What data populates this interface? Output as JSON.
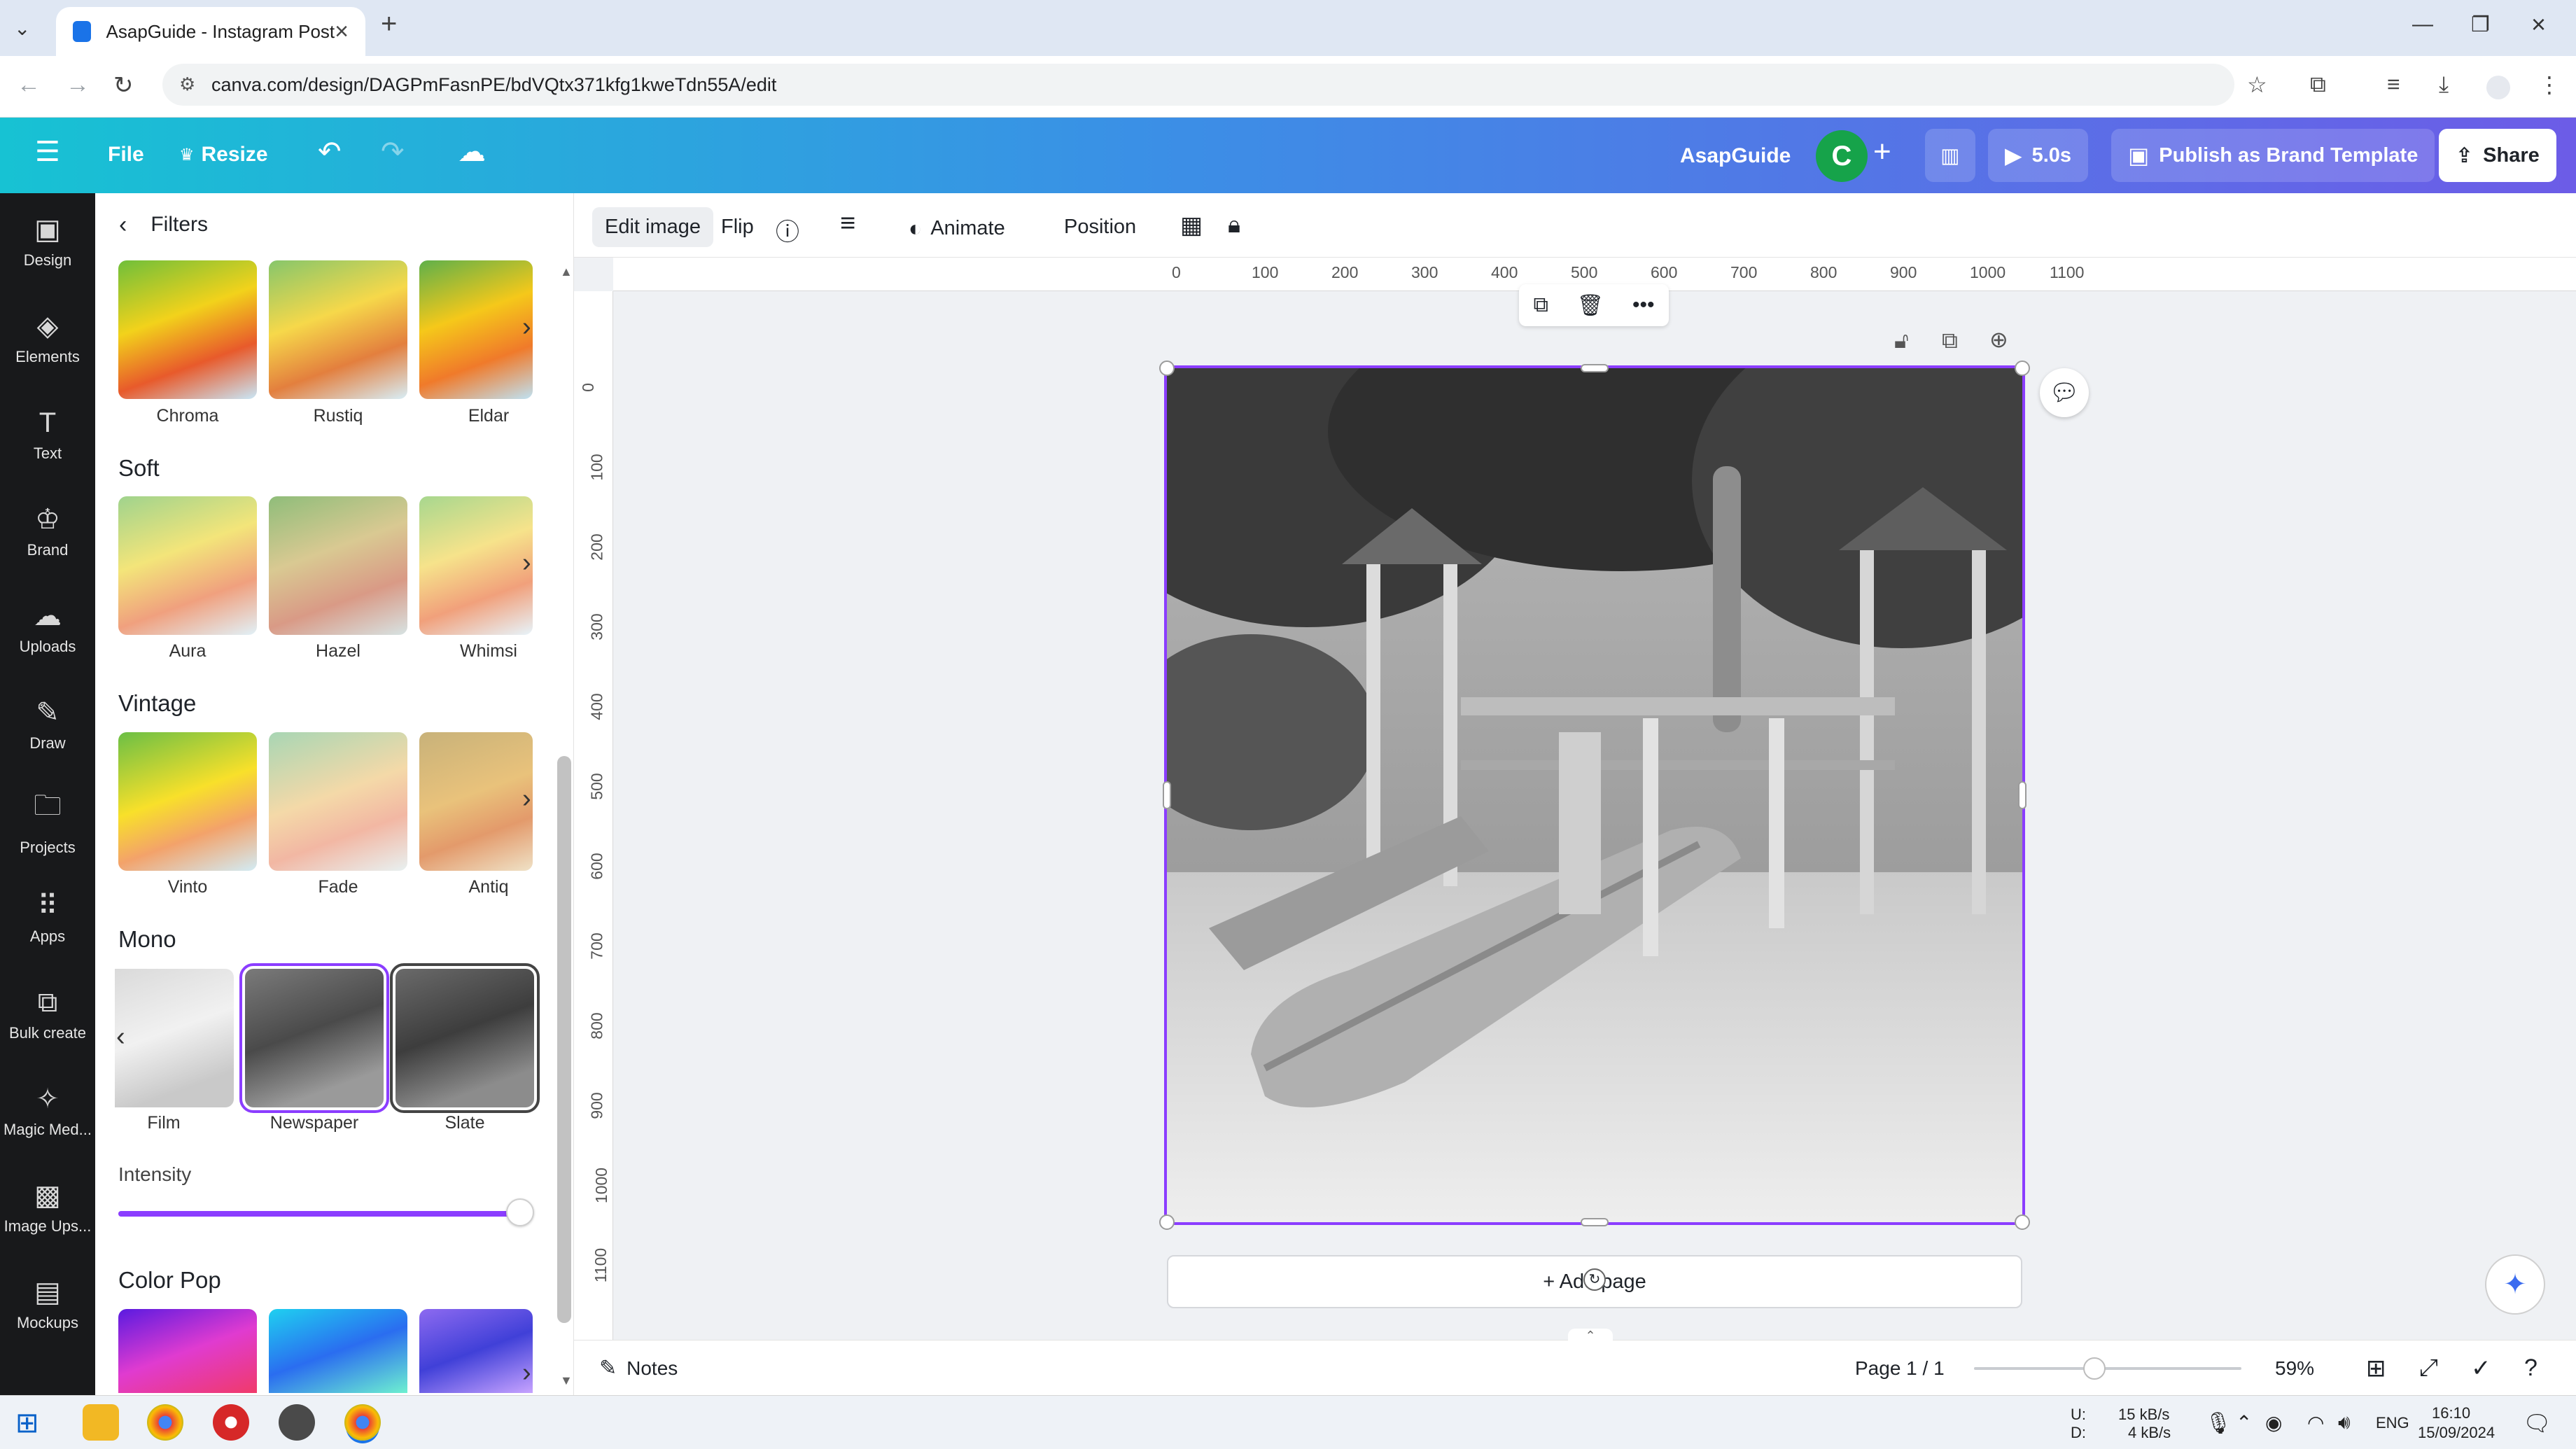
{
  "browser": {
    "tab_title": "AsapGuide - Instagram Post",
    "url": "canva.com/design/DAGPmFasnPE/bdVQtx371kfg1kweTdn55A/edit",
    "new_tab": "+"
  },
  "header": {
    "file": "File",
    "resize": "Resize",
    "brand_name": "AsapGuide",
    "avatar_letter": "C",
    "play_duration": "5.0s",
    "publish": "Publish as Brand Template",
    "share": "Share"
  },
  "rail": [
    {
      "label": "Design",
      "icon": "layout-icon"
    },
    {
      "label": "Elements",
      "icon": "shapes-icon"
    },
    {
      "label": "Text",
      "icon": "text-icon"
    },
    {
      "label": "Brand",
      "icon": "brand-icon"
    },
    {
      "label": "Uploads",
      "icon": "cloud-upload-icon"
    },
    {
      "label": "Draw",
      "icon": "pen-icon"
    },
    {
      "label": "Projects",
      "icon": "folder-icon"
    },
    {
      "label": "Apps",
      "icon": "grid-icon"
    },
    {
      "label": "Bulk create",
      "icon": "bulk-icon"
    },
    {
      "label": "Magic Med...",
      "icon": "magic-media-icon"
    },
    {
      "label": "Image Ups...",
      "icon": "image-upscaler-icon"
    },
    {
      "label": "Mockups",
      "icon": "mockups-icon"
    }
  ],
  "panel": {
    "title": "Filters",
    "row0": [
      "Chroma",
      "Rustiq",
      "Eldar"
    ],
    "soft_title": "Soft",
    "soft": [
      "Aura",
      "Hazel",
      "Whimsi"
    ],
    "vintage_title": "Vintage",
    "vintage": [
      "Vinto",
      "Fade",
      "Antiq"
    ],
    "mono_title": "Mono",
    "mono": [
      "Film",
      "Newspaper",
      "Slate"
    ],
    "intensity_label": "Intensity",
    "intensity_value": 1.0,
    "colorpop_title": "Color Pop"
  },
  "toolbar": {
    "edit_image": "Edit image",
    "flip": "Flip",
    "animate": "Animate",
    "position": "Position"
  },
  "ruler": {
    "h": [
      "0",
      "100",
      "200",
      "300",
      "400",
      "500",
      "600",
      "700",
      "800",
      "900",
      "1000",
      "1100"
    ],
    "v": [
      "0",
      "100",
      "200",
      "300",
      "400",
      "500",
      "600",
      "700",
      "800",
      "900",
      "1000",
      "1100"
    ]
  },
  "canvas": {
    "add_page": "+ Add page"
  },
  "status": {
    "notes": "Notes",
    "page": "Page 1 / 1",
    "zoom": "59%",
    "zoom_fraction": 0.45
  },
  "taskbar": {
    "net_up": "15 kB/s",
    "net_down": "4 kB/s",
    "net_u_label": "U:",
    "net_d_label": "D:",
    "lang": "ENG",
    "time": "16:10",
    "date": "15/09/2024"
  },
  "colors": {
    "accent": "#8b3dff",
    "header_start": "#17c2d3",
    "header_end": "#6c5ce7",
    "rail_bg": "#18191b"
  }
}
